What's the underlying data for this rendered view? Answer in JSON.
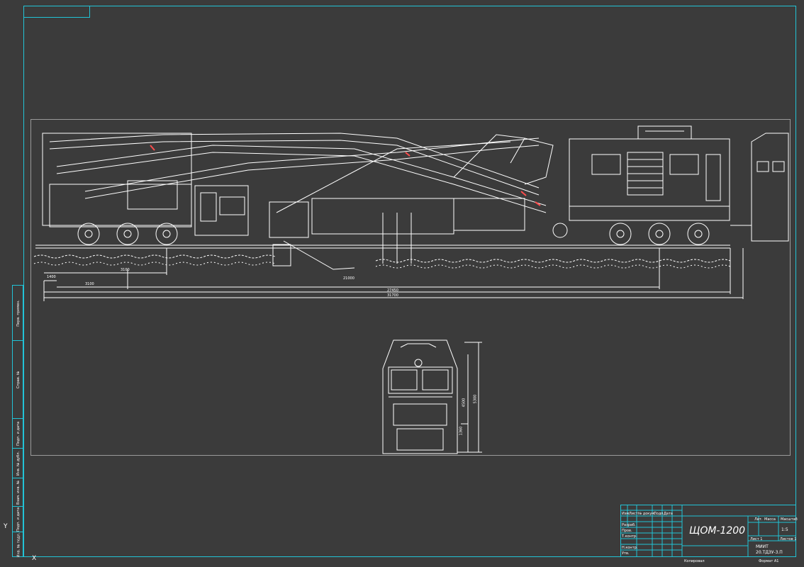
{
  "drawing": {
    "title": "ЩОМ-1200",
    "sheet_code": "20.ТДЗУ-3.П",
    "organization": "МИИТ",
    "format_label": "Формат А1",
    "copied_label": "Копировал",
    "scale_label": "1:5",
    "sheet_label": "Лист 1",
    "sheets_label": "Листов 1",
    "mass_label": "Масса"
  },
  "dimensions": {
    "d1": "1400",
    "d2": "3100",
    "d3": "3100",
    "d4": "21000",
    "d5": "27450",
    "d6": "31700",
    "h1": "1360",
    "h2": "4500",
    "h3": "5300"
  },
  "side_strip": {
    "labels": [
      "Перв. примен.",
      "Справ. №",
      "Подп. и дата",
      "Инв. № дубл.",
      "Взам. инв. №",
      "Подп. и дата",
      "Инв. № подл."
    ]
  },
  "title_block": {
    "rows": [
      "Изм.",
      "Лист",
      "№ докум.",
      "Подп.",
      "Дата",
      "Разраб.",
      "Пров.",
      "Т.контр.",
      "Н.контр.",
      "Утв."
    ],
    "col_lit": "Лит.",
    "col_mass": "Масса",
    "col_scale": "Масштаб"
  },
  "colors": {
    "background": "#3b3b3b",
    "frame": "#22c3d6",
    "lines": "#ffffff",
    "accent": "#ff4d4d"
  },
  "axis": {
    "x": "X",
    "y": "Y"
  }
}
